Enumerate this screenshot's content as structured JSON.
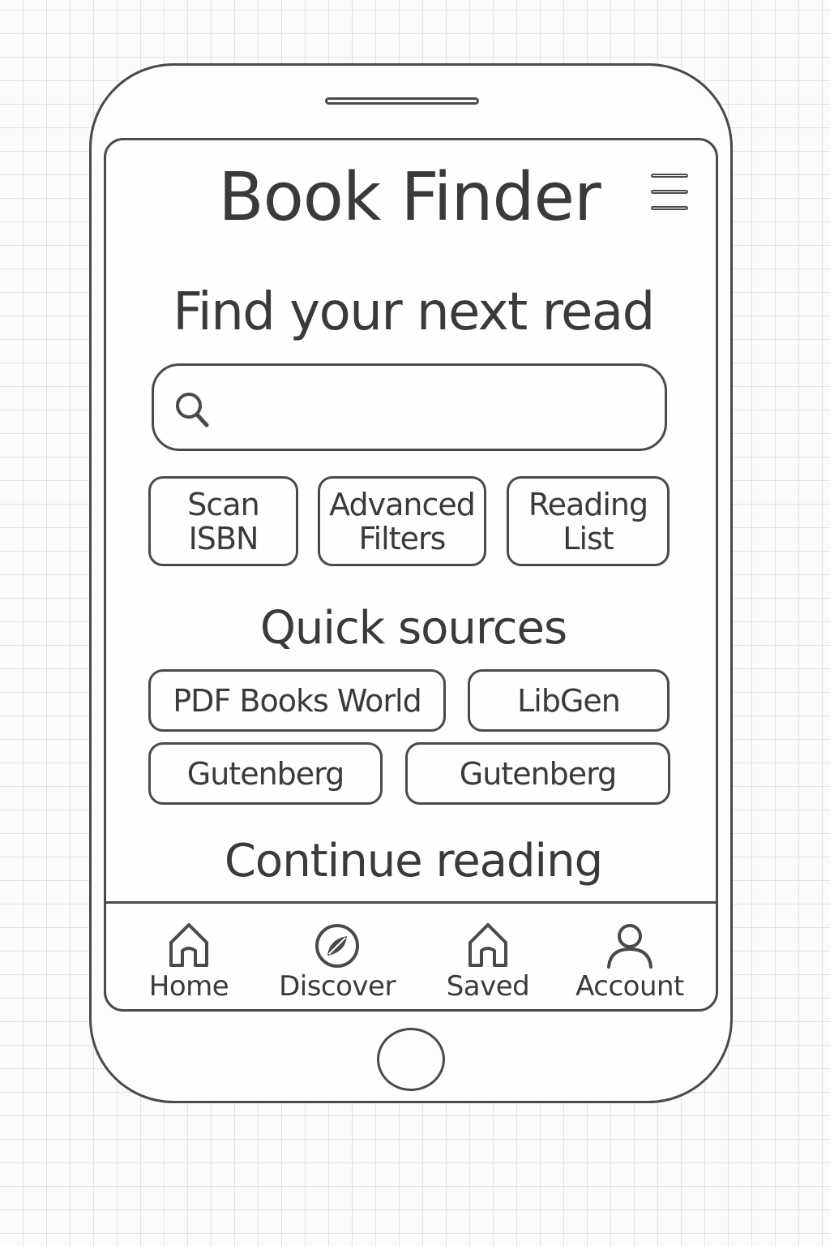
{
  "app": {
    "title": "Book Finder"
  },
  "hero": {
    "heading": "Find your next read"
  },
  "search": {
    "placeholder": "",
    "value": ""
  },
  "actions": [
    {
      "label": "Scan\nISBN"
    },
    {
      "label": "Advanced\nFilters"
    },
    {
      "label": "Reading\nList"
    }
  ],
  "quick_sources": {
    "heading": "Quick sources",
    "items": [
      {
        "label": "PDF Books World"
      },
      {
        "label": "LibGen"
      },
      {
        "label": "Gutenberg"
      },
      {
        "label": "Gutenberg"
      }
    ]
  },
  "continue_reading": {
    "heading": "Continue reading"
  },
  "nav": {
    "items": [
      {
        "label": "Home",
        "icon": "home-icon"
      },
      {
        "label": "Discover",
        "icon": "compass-icon"
      },
      {
        "label": "Saved",
        "icon": "saved-home-icon"
      },
      {
        "label": "Account",
        "icon": "user-icon"
      }
    ]
  },
  "colors": {
    "stroke": "#4a4a4a",
    "text": "#3a3a3a",
    "grid": "#e2e2e2"
  }
}
